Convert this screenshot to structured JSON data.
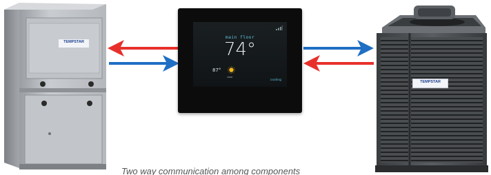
{
  "furnace": {
    "brand": "TEMPSTAR",
    "brand_tagline": ""
  },
  "thermostat": {
    "zone_label": "main floor",
    "set_temp": "74°",
    "outdoor_temp": "87°",
    "weather": "clear",
    "mode": "cooling",
    "weather_icon": "sun-icon",
    "signal_icon": "signal-icon"
  },
  "condenser": {
    "brand": "TEMPSTAR",
    "brand_tagline": ""
  },
  "arrows": {
    "red_color": "#e8302b",
    "blue_color": "#1f6fc4"
  },
  "caption": "Two way communication among components"
}
